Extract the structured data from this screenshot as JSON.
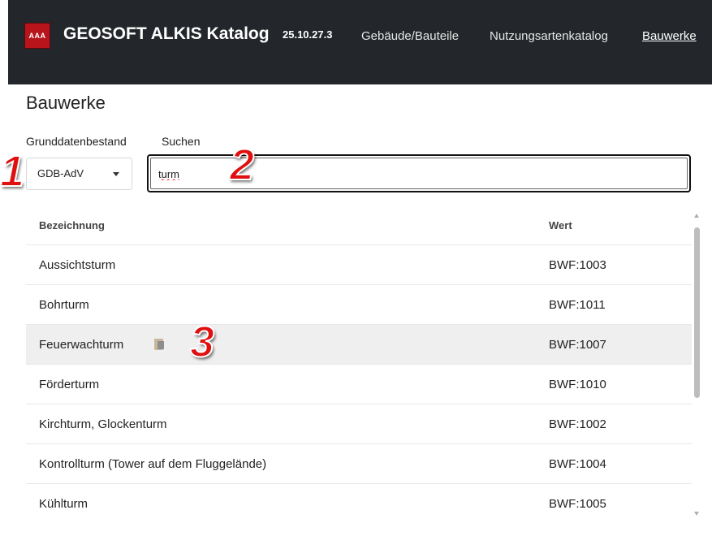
{
  "header": {
    "logo_text": "AAA",
    "brand": "GEOSOFT ALKIS Katalog",
    "version": "25.10.27.3",
    "nav": [
      {
        "label": "Gebäude/Bauteile"
      },
      {
        "label": "Nutzungsartenkatalog"
      },
      {
        "label": "Bauwerke"
      }
    ]
  },
  "page": {
    "title": "Bauwerke",
    "grunddaten_label": "Grunddatenbestand",
    "suchen_label": "Suchen",
    "grunddaten_value": "GDB-AdV",
    "search_value": "turm"
  },
  "table": {
    "headers": {
      "bezeichnung": "Bezeichnung",
      "wert": "Wert"
    },
    "rows": [
      {
        "name": "Aussichtsturm",
        "wert": "BWF:1003"
      },
      {
        "name": "Bohrturm",
        "wert": "BWF:1011"
      },
      {
        "name": "Feuerwachturm",
        "wert": "BWF:1007"
      },
      {
        "name": "Förderturm",
        "wert": "BWF:1010"
      },
      {
        "name": "Kirchturm, Glockenturm",
        "wert": "BWF:1002"
      },
      {
        "name": "Kontrollturm (Tower auf dem Fluggelände)",
        "wert": "BWF:1004"
      },
      {
        "name": "Kühlturm",
        "wert": "BWF:1005"
      }
    ]
  },
  "annotations": {
    "a1": "1",
    "a2": "2",
    "a3": "3"
  },
  "colors": {
    "header_bg": "#23272b",
    "logo_red": "#b8141c",
    "annotation_red": "#e01010",
    "row_highlight": "#efefef"
  }
}
